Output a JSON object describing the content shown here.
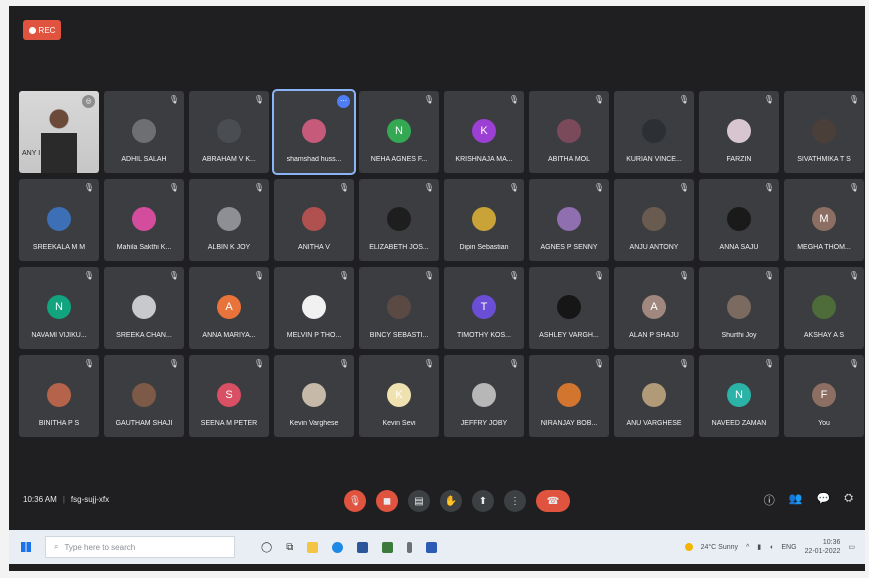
{
  "recording": {
    "label": "REC"
  },
  "participants": [
    {
      "name": "ANY I",
      "type": "video"
    },
    {
      "name": "ADHIL SALAH",
      "avatar_color": "#6d6f73"
    },
    {
      "name": "ABRAHAM V K...",
      "avatar_color": "#4a4d52"
    },
    {
      "name": "shamshad huss...",
      "avatar_color": "#c65a7a",
      "active": true
    },
    {
      "name": "NEHA AGNES F...",
      "avatar_color": "#34a853",
      "initial": "N"
    },
    {
      "name": "KRISHNAJA MA...",
      "avatar_color": "#9c3fd4",
      "initial": "K"
    },
    {
      "name": "ABITHA MOL",
      "avatar_color": "#7a4a5a"
    },
    {
      "name": "KURIAN VINCE...",
      "avatar_color": "#2c2f33"
    },
    {
      "name": "FARZIN",
      "avatar_color": "#d7c6cf"
    },
    {
      "name": "SIVATHMIKA T S",
      "avatar_color": "#4b3f3a"
    },
    {
      "name": "SREEKALA M M",
      "avatar_color": "#3d6fb6"
    },
    {
      "name": "Mahila Sakthi K...",
      "avatar_color": "#d44d9c"
    },
    {
      "name": "ALBIN K JOY",
      "avatar_color": "#8d8f94"
    },
    {
      "name": "ANITHA V",
      "avatar_color": "#b0514f"
    },
    {
      "name": "ELIZABETH JOS...",
      "avatar_color": "#1e1e1e"
    },
    {
      "name": "Dipin Sebastian",
      "avatar_color": "#c9a338"
    },
    {
      "name": "AGNES P SENNY",
      "avatar_color": "#8f6fb0"
    },
    {
      "name": "ANJU ANTONY",
      "avatar_color": "#6a5b50"
    },
    {
      "name": "ANNA SAJU",
      "avatar_color": "#1a1a1a"
    },
    {
      "name": "MEGHA THOM...",
      "avatar_color": "#8d6e63",
      "initial": "M"
    },
    {
      "name": "NAVAMI VIJIKU...",
      "avatar_color": "#12a37f",
      "initial": "N"
    },
    {
      "name": "SREEKA CHAN...",
      "avatar_color": "#c7c9cc"
    },
    {
      "name": "ANNA MARIYA...",
      "avatar_color": "#e8743b",
      "initial": "A"
    },
    {
      "name": "MELVIN P THO...",
      "avatar_color": "#f1f1f1"
    },
    {
      "name": "BINCY SEBASTI...",
      "avatar_color": "#5b4a44"
    },
    {
      "name": "TIMOTHY KOS...",
      "avatar_color": "#6a4fd6",
      "initial": "T"
    },
    {
      "name": "ASHLEY VARGH...",
      "avatar_color": "#161616"
    },
    {
      "name": "ALAN P SHAJU",
      "avatar_color": "#a1887f",
      "initial": "A"
    },
    {
      "name": "Shurthi Joy",
      "avatar_color": "#7a6a60"
    },
    {
      "name": "AKSHAY A S",
      "avatar_color": "#4e6b3a"
    },
    {
      "name": "BINITHA P S",
      "avatar_color": "#b5634a"
    },
    {
      "name": "GAUTHAM SHAJI",
      "avatar_color": "#7d5a48"
    },
    {
      "name": "SEENA M PETER",
      "avatar_color": "#d94f64",
      "initial": "S"
    },
    {
      "name": "Kevin Varghese",
      "avatar_color": "#c7b9a8"
    },
    {
      "name": "Kevin Sevi",
      "avatar_color": "#efe1b0",
      "initial": "K"
    },
    {
      "name": "JEFFRY JOBY",
      "avatar_color": "#b7b7b7"
    },
    {
      "name": "NIRANJAY BOB...",
      "avatar_color": "#d2752f"
    },
    {
      "name": "ANU VARGHESE",
      "avatar_color": "#b09a78"
    },
    {
      "name": "NAVEED ZAMAN",
      "avatar_color": "#2bb3a8",
      "initial": "N"
    },
    {
      "name": "You",
      "avatar_color": "#8d6e63",
      "initial": "F"
    }
  ],
  "meeting": {
    "time": "10:36 AM",
    "separator": "|",
    "code": "fsg-sujj-xfx"
  },
  "taskbar": {
    "search_placeholder": "Type here to search",
    "weather": "24°C Sunny",
    "clock_time": "10:36",
    "clock_date": "22-01-2022",
    "lang": "ENG"
  }
}
